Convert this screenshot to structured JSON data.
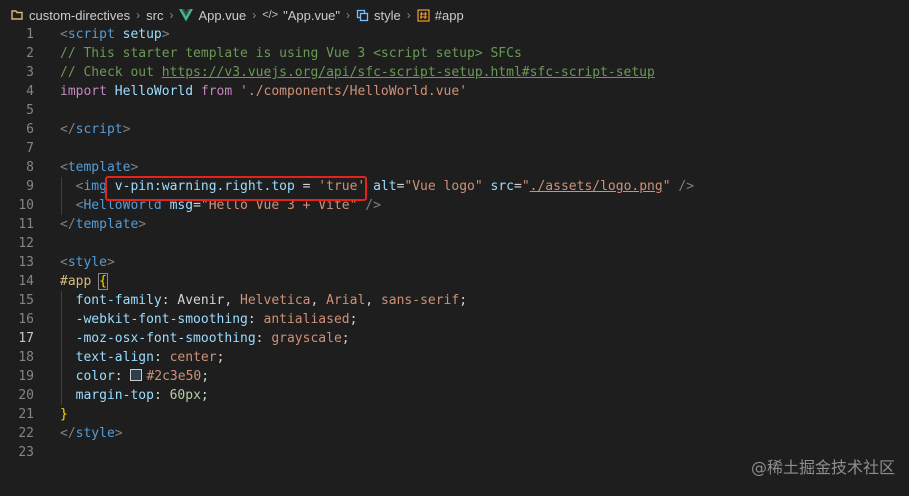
{
  "breadcrumb": {
    "folder": "custom-directives",
    "src": "src",
    "file": "App.vue",
    "component": "\"App.vue\"",
    "style": "style",
    "selector": "#app"
  },
  "active_line": "17",
  "lines": [
    {
      "n": "1",
      "tokens": [
        {
          "t": "<",
          "c": "punc"
        },
        {
          "t": "script",
          "c": "tag"
        },
        {
          "t": " ",
          "c": "text"
        },
        {
          "t": "setup",
          "c": "attr"
        },
        {
          "t": ">",
          "c": "punc"
        }
      ]
    },
    {
      "n": "2",
      "tokens": [
        {
          "t": "// This starter template is using Vue 3 <script setup> SFCs",
          "c": "comment"
        }
      ]
    },
    {
      "n": "3",
      "tokens": [
        {
          "t": "// Check out ",
          "c": "comment"
        },
        {
          "t": "https://v3.vuejs.org/api/sfc-script-setup.html#sfc-script-setup",
          "c": "link"
        }
      ]
    },
    {
      "n": "4",
      "tokens": [
        {
          "t": "import",
          "c": "kw"
        },
        {
          "t": " ",
          "c": "text"
        },
        {
          "t": "HelloWorld",
          "c": "id"
        },
        {
          "t": " ",
          "c": "text"
        },
        {
          "t": "from",
          "c": "kw"
        },
        {
          "t": " ",
          "c": "text"
        },
        {
          "t": "'./components/HelloWorld.vue'",
          "c": "str"
        }
      ]
    },
    {
      "n": "5",
      "tokens": []
    },
    {
      "n": "6",
      "tokens": [
        {
          "t": "</",
          "c": "punc"
        },
        {
          "t": "script",
          "c": "tag"
        },
        {
          "t": ">",
          "c": "punc"
        }
      ]
    },
    {
      "n": "7",
      "tokens": []
    },
    {
      "n": "8",
      "tokens": [
        {
          "t": "<",
          "c": "punc"
        },
        {
          "t": "template",
          "c": "tag"
        },
        {
          "t": ">",
          "c": "punc"
        }
      ]
    },
    {
      "n": "9",
      "tokens": [
        {
          "t": "  ",
          "c": "text"
        },
        {
          "t": "<",
          "c": "punc"
        },
        {
          "t": "img",
          "c": "tag"
        },
        {
          "t": " ",
          "c": "text"
        },
        {
          "t": "v-pin:warning.right.top",
          "c": "attr"
        },
        {
          "t": " = ",
          "c": "text"
        },
        {
          "t": "'true'",
          "c": "str"
        },
        {
          "t": " ",
          "c": "text"
        },
        {
          "t": "alt",
          "c": "attr"
        },
        {
          "t": "=",
          "c": "text"
        },
        {
          "t": "\"Vue logo\"",
          "c": "str"
        },
        {
          "t": " ",
          "c": "text"
        },
        {
          "t": "src",
          "c": "attr"
        },
        {
          "t": "=",
          "c": "text"
        },
        {
          "t": "\"",
          "c": "str"
        },
        {
          "t": "./assets/logo.png",
          "c": "strlink"
        },
        {
          "t": "\"",
          "c": "str"
        },
        {
          "t": " />",
          "c": "punc"
        }
      ]
    },
    {
      "n": "10",
      "tokens": [
        {
          "t": "  ",
          "c": "text"
        },
        {
          "t": "<",
          "c": "punc"
        },
        {
          "t": "HelloWorld",
          "c": "tag"
        },
        {
          "t": " ",
          "c": "text"
        },
        {
          "t": "msg",
          "c": "attr"
        },
        {
          "t": "=",
          "c": "text"
        },
        {
          "t": "\"Hello Vue 3 + Vite\"",
          "c": "str"
        },
        {
          "t": " />",
          "c": "punc"
        }
      ]
    },
    {
      "n": "11",
      "tokens": [
        {
          "t": "</",
          "c": "punc"
        },
        {
          "t": "template",
          "c": "tag"
        },
        {
          "t": ">",
          "c": "punc"
        }
      ]
    },
    {
      "n": "12",
      "tokens": []
    },
    {
      "n": "13",
      "tokens": [
        {
          "t": "<",
          "c": "punc"
        },
        {
          "t": "style",
          "c": "tag"
        },
        {
          "t": ">",
          "c": "punc"
        }
      ]
    },
    {
      "n": "14",
      "tokens": [
        {
          "t": "#app",
          "c": "sel"
        },
        {
          "t": " ",
          "c": "text"
        },
        {
          "t": "{",
          "c": "brace"
        }
      ]
    },
    {
      "n": "15",
      "tokens": [
        {
          "t": "  ",
          "c": "text"
        },
        {
          "t": "font-family",
          "c": "prop"
        },
        {
          "t": ": ",
          "c": "text"
        },
        {
          "t": "Avenir",
          "c": "text"
        },
        {
          "t": ", ",
          "c": "text"
        },
        {
          "t": "Helvetica",
          "c": "val"
        },
        {
          "t": ", ",
          "c": "text"
        },
        {
          "t": "Arial",
          "c": "val"
        },
        {
          "t": ", ",
          "c": "text"
        },
        {
          "t": "sans-serif",
          "c": "val"
        },
        {
          "t": ";",
          "c": "text"
        }
      ]
    },
    {
      "n": "16",
      "tokens": [
        {
          "t": "  ",
          "c": "text"
        },
        {
          "t": "-webkit-font-smoothing",
          "c": "prop"
        },
        {
          "t": ": ",
          "c": "text"
        },
        {
          "t": "antialiased",
          "c": "val"
        },
        {
          "t": ";",
          "c": "text"
        }
      ]
    },
    {
      "n": "17",
      "tokens": [
        {
          "t": "  ",
          "c": "text"
        },
        {
          "t": "-moz-osx-font-smoothing",
          "c": "prop"
        },
        {
          "t": ": ",
          "c": "text"
        },
        {
          "t": "grayscale",
          "c": "val"
        },
        {
          "t": ";",
          "c": "text"
        }
      ]
    },
    {
      "n": "18",
      "tokens": [
        {
          "t": "  ",
          "c": "text"
        },
        {
          "t": "text-align",
          "c": "prop"
        },
        {
          "t": ": ",
          "c": "text"
        },
        {
          "t": "center",
          "c": "val"
        },
        {
          "t": ";",
          "c": "text"
        }
      ]
    },
    {
      "n": "19",
      "tokens": [
        {
          "t": "  ",
          "c": "text"
        },
        {
          "t": "color",
          "c": "prop"
        },
        {
          "t": ": ",
          "c": "text"
        },
        {
          "t": "",
          "c": "swatch"
        },
        {
          "t": "#2c3e50",
          "c": "val"
        },
        {
          "t": ";",
          "c": "text"
        }
      ]
    },
    {
      "n": "20",
      "tokens": [
        {
          "t": "  ",
          "c": "text"
        },
        {
          "t": "margin-top",
          "c": "prop"
        },
        {
          "t": ": ",
          "c": "text"
        },
        {
          "t": "60px",
          "c": "num"
        },
        {
          "t": ";",
          "c": "text"
        }
      ]
    },
    {
      "n": "21",
      "tokens": [
        {
          "t": "}",
          "c": "brace"
        }
      ]
    },
    {
      "n": "22",
      "tokens": [
        {
          "t": "</",
          "c": "punc"
        },
        {
          "t": "style",
          "c": "tag"
        },
        {
          "t": ">",
          "c": "punc"
        }
      ]
    },
    {
      "n": "23",
      "tokens": []
    }
  ],
  "watermark": "@稀土掘金技术社区",
  "colors": {
    "background": "#1e1e1e",
    "highlight": "#e5231b",
    "swatch": "#2c3e50"
  }
}
